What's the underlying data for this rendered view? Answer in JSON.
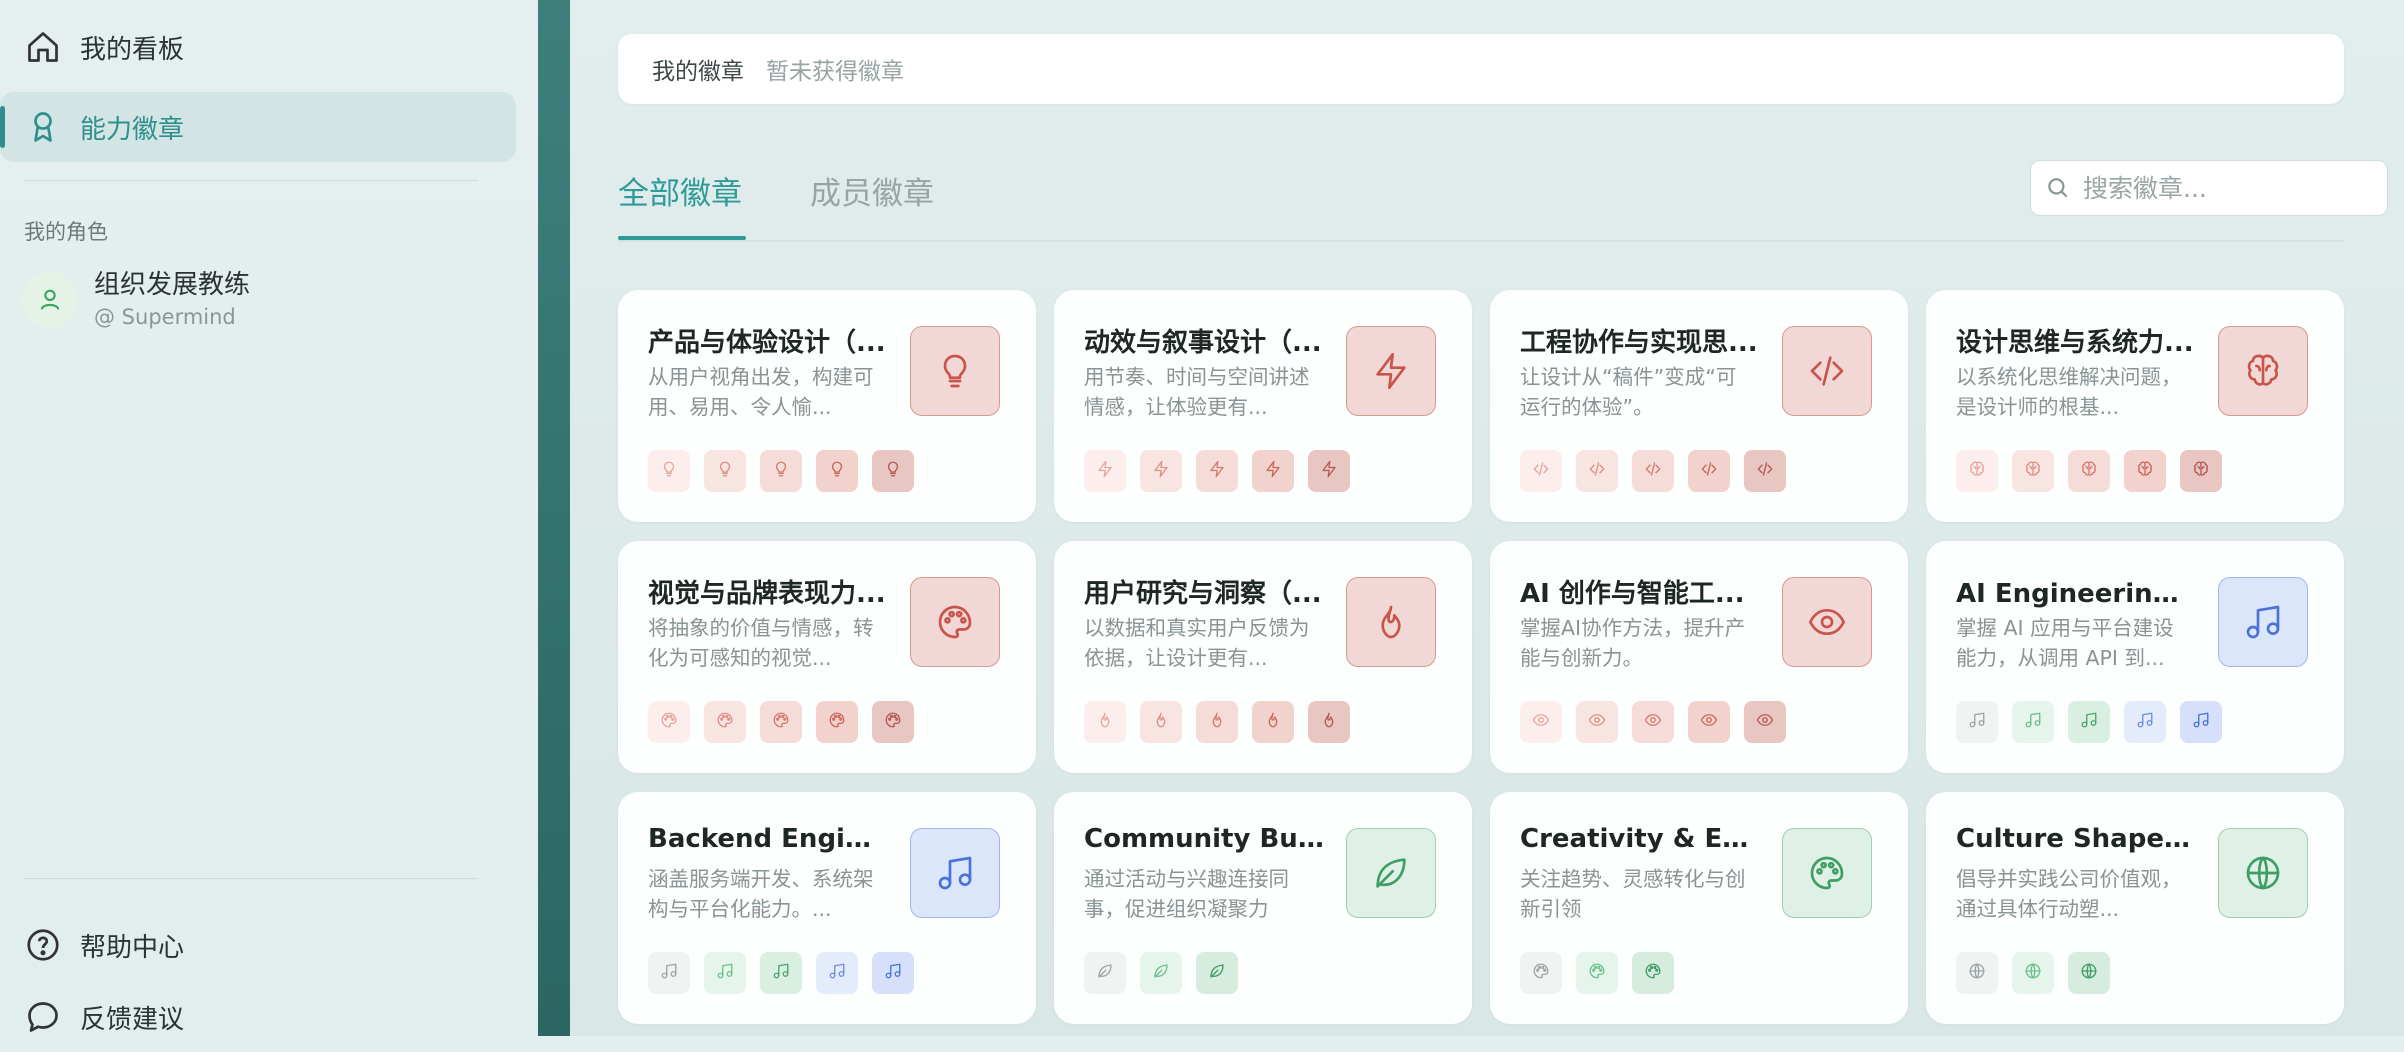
{
  "sidebar": {
    "nav": [
      {
        "label": "我的看板",
        "icon": "home-icon"
      },
      {
        "label": "能力徽章",
        "icon": "badge-icon",
        "active": true
      }
    ],
    "roles_label": "我的角色",
    "role": {
      "name": "组织发展教练",
      "org": "@ Supermind",
      "icon": "user-icon"
    },
    "footer": [
      {
        "label": "帮助中心",
        "icon": "help-icon"
      },
      {
        "label": "反馈建议",
        "icon": "feedback-icon"
      }
    ]
  },
  "main": {
    "my_badges": {
      "label": "我的徽章",
      "value": "暂未获得徽章"
    },
    "tabs": [
      {
        "label": "全部徽章",
        "active": true
      },
      {
        "label": "成员徽章"
      }
    ],
    "search": {
      "placeholder": "搜索徽章..."
    },
    "cards": [
      {
        "title": "产品与体验设计（...",
        "desc": "从用户视角出发，构建可用、易用、令人愉...",
        "icon": "lightbulb-icon",
        "tone": "red"
      },
      {
        "title": "动效与叙事设计（...",
        "desc": "用节奏、时间与空间讲述情感，让体验更有...",
        "icon": "lightning-icon",
        "tone": "red"
      },
      {
        "title": "工程协作与实现思...",
        "desc": "让设计从“稿件”变成“可运行的体验”。",
        "icon": "code-icon",
        "tone": "red"
      },
      {
        "title": "设计思维与系统力...",
        "desc": "以系统化思维解决问题，是设计师的根基...",
        "icon": "brain-icon",
        "tone": "red"
      },
      {
        "title": "视觉与品牌表现力...",
        "desc": "将抽象的价值与情感，转化为可感知的视觉...",
        "icon": "palette-icon",
        "tone": "red"
      },
      {
        "title": "用户研究与洞察（...",
        "desc": "以数据和真实用户反馈为依据，让设计更有...",
        "icon": "flame-icon",
        "tone": "red"
      },
      {
        "title": "AI 创作与智能工...",
        "desc": "掌握AI协作方法，提升产能与创新力。",
        "icon": "eye-icon",
        "tone": "red"
      },
      {
        "title": "AI Engineering（...",
        "desc": "掌握 AI 应用与平台建设能力，从调用 API 到...",
        "icon": "music-icon",
        "tone": "blue"
      },
      {
        "title": "Backend Engine...",
        "desc": "涵盖服务端开发、系统架构与平台化能力。...",
        "icon": "music-icon",
        "tone": "blue"
      },
      {
        "title": "Community Buil...",
        "desc": "通过活动与兴趣连接同事，促进组织凝聚力",
        "icon": "leaf-icon",
        "tone": "green"
      },
      {
        "title": "Creativity & Expl...",
        "desc": "关注趋势、灵感转化与创新引领",
        "icon": "palette-icon",
        "tone": "green"
      },
      {
        "title": "Culture Shaper...",
        "desc": "倡导并实践公司价值观，通过具体行动塑...",
        "icon": "globe-icon",
        "tone": "green"
      }
    ]
  },
  "colors": {
    "accent": "#2f9b98",
    "rail": "#2b6663",
    "red": "#c9544a",
    "blue": "#4a72d9",
    "green": "#3f9e63"
  }
}
